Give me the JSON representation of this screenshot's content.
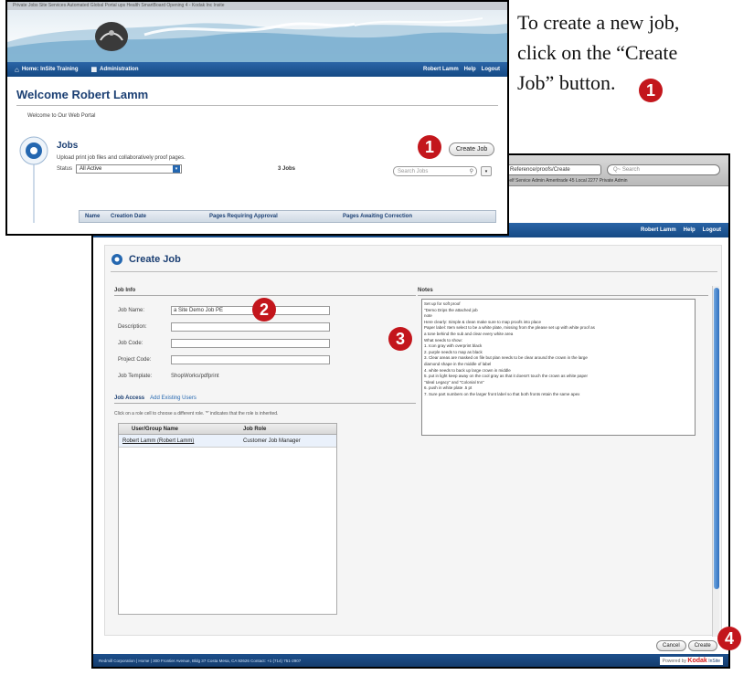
{
  "instruction": {
    "line1": "To create a new job,",
    "line2": "click on the “Create",
    "line3": "Job” button."
  },
  "callouts": [
    "1",
    "2",
    "3",
    "4"
  ],
  "front": {
    "browser_bar_text": "Private Jobs  Site Services  Automated  Global Portal  ups  Health  SmartBoard  Opening  4 - Kodak Inc  Insite",
    "nav": {
      "home_label": "Home: InSite Training",
      "admin_label": "Administration",
      "user_label": "Robert Lamm",
      "help_label": "Help",
      "logout_label": "Logout"
    },
    "welcome": "Welcome Robert Lamm",
    "portal_text": "Welcome to Our Web Portal",
    "jobs": {
      "title": "Jobs",
      "description": "Upload print job files and collaboratively proof pages.",
      "status_label": "Status",
      "status_value": "All Active",
      "count": "3 Jobs",
      "search_placeholder": "Search Jobs",
      "create_button": "Create Job",
      "columns": [
        "Name",
        "Creation Date",
        "Pages Requiring Approval",
        "Pages Awaiting Correction"
      ]
    }
  },
  "back": {
    "address_text": "Reference/proofs/Create",
    "search_placeholder": "Q~ Search",
    "bookmarks_text": "Self Service Admin   Ameritrade 45   Local 2277   Private Admin",
    "page_title": "Create Job",
    "job_info": {
      "header": "Job Info",
      "job_name_label": "Job Name:",
      "job_name_value": "a Site Demo Job PE",
      "description_label": "Description:",
      "job_code_label": "Job Code:",
      "project_code_label": "Project Code:",
      "job_template_label": "Job Template:",
      "job_template_value": "ShopWorks/pdfprint"
    },
    "notes": {
      "header": "Notes",
      "text": "Set up for soft proof\n\"Demo Drips the attached job\nnote\nHere clearly: Simple & clean make sure to map proofs into place\nPaper label: Item select to be a white plate, missing from the please set up with white proof as\na tone behind the sub and clear every white area\nWhat needs to show:\n1. Icon gray with overprint black\n2. purple needs to map as black\n3. Clear areas are masked on file but plan needs to be clear around the crown in the large\ndiamond shape in the middle of label\n4. white needs to back up large crown in middle\n5. put in light keep away on the cool gray as that it doesn't touch the crown as white paper\n\"Ideal Legacy\" and \"Colonial Inn\"\n6. push in white plate .5 pt\n7. Sure part numbers on the larger front label so that both fronts retain the same apex"
    },
    "job_access": {
      "tab_label": "Job Access",
      "add_link": "Add Existing Users",
      "hint": "Click on a role cell to choose a different role. '*' indicates that the role is inherited.",
      "columns": [
        "User/Group Name",
        "Job Role"
      ],
      "rows": [
        {
          "name": "Robert Lamm (Robert Lamm)",
          "role": "Customer Job Manager"
        }
      ]
    },
    "cancel_label": "Cancel",
    "create_label": "Create",
    "footer_text": "Redmill Corporation  |  Home  |  300 Frontier Avenue, Bldg 37 Costa Mesa, CA 92626  Contact: +1 (714) 751-2907",
    "powered_by": "Powered by",
    "brand": "Kodak",
    "brand_suffix": "InSite"
  },
  "colors": {
    "callout": "#c3161c",
    "nav_blue": "#1f5a99",
    "kodak_red": "#d11a1a"
  }
}
